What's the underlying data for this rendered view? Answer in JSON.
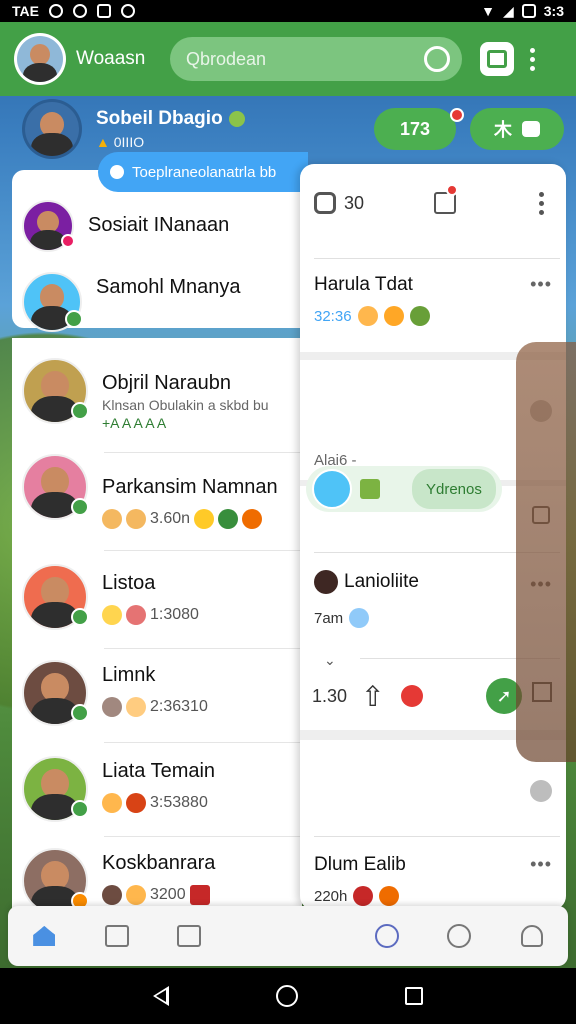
{
  "statusbar": {
    "left_text": "TAE",
    "time": "3:3"
  },
  "appbar": {
    "title": "Woaasn",
    "search_placeholder": "Qbrodean"
  },
  "profile": {
    "name": "Sobeil Dbagio",
    "sub": "0IIIO"
  },
  "pills": {
    "count": "173",
    "action": "木"
  },
  "pinned": {
    "name": "Sosiait INanaan",
    "second_name": "Samohl Mnanya",
    "message": "Toeplraneolanatrla bb"
  },
  "chats": [
    {
      "name": "Objril Naraubn",
      "sub1": "Klnsan Obulakin a skbd bu",
      "sub2": "+A A A A A"
    },
    {
      "name": "Parkansim Namnan",
      "meta": "3.60n"
    },
    {
      "name": "Listoa",
      "meta": "1:3080"
    },
    {
      "name": "Limnk",
      "meta": "2:36310"
    },
    {
      "name": "Liata Temain",
      "meta": "3:53880"
    },
    {
      "name": "Koskbanrara",
      "meta": "3200"
    }
  ],
  "right": {
    "header_count": "30",
    "c1_name": "Harula Tdat",
    "c1_time": "32:36",
    "c2_label": "Alai6 -",
    "typing_label": "Ydrenos",
    "c3_name": "Lanioliite",
    "c3_time": "7am",
    "c3_count": "1.30",
    "c4_name": "Dlum Ealib",
    "c4_time": "220h"
  },
  "colors": {
    "primary_green": "#43a047",
    "accent_blue": "#42a5f5",
    "alert_red": "#e53935",
    "panel_white": "#ffffff"
  }
}
